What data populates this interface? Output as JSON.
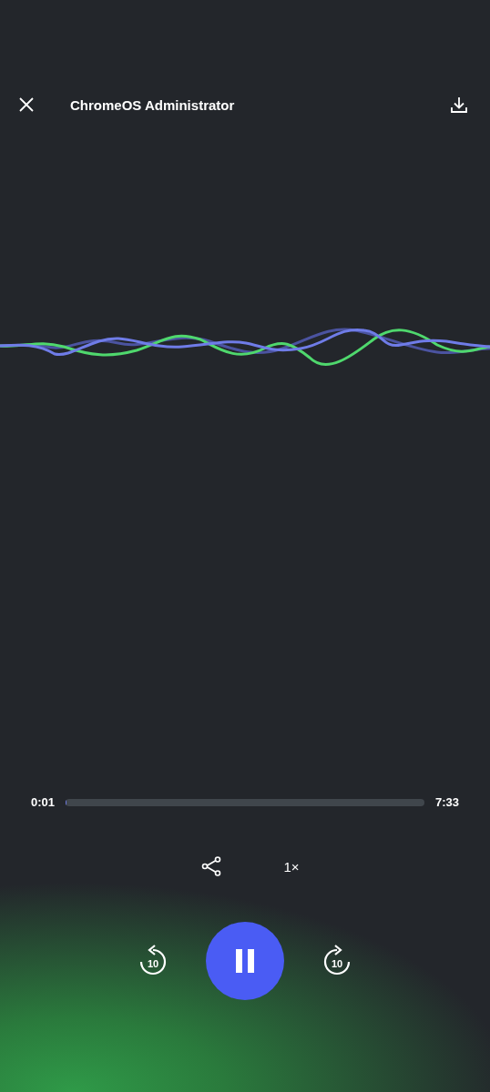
{
  "header": {
    "title": "ChromeOS Administrator"
  },
  "progress": {
    "elapsed": "0:01",
    "total": "7:33",
    "level": 0.002
  },
  "speed": "1×",
  "playback": {
    "playing": true,
    "skip_back": "10",
    "skip_forward": "10"
  }
}
